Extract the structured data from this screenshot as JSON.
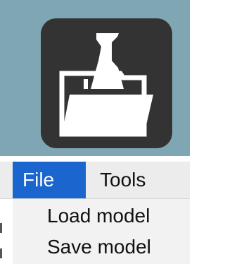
{
  "icon": {
    "name": "bookmark-folder-icon",
    "panel_color": "#7fa7b3",
    "tile_color": "#333333",
    "glyph_color": "#ffffff"
  },
  "menubar": {
    "items": [
      {
        "label": "File",
        "selected": true
      },
      {
        "label": "Tools",
        "selected": false
      }
    ],
    "selected_color": "#1b65cf"
  },
  "dropdown": {
    "items": [
      {
        "label": "Load model"
      },
      {
        "label": "Save model"
      }
    ]
  }
}
